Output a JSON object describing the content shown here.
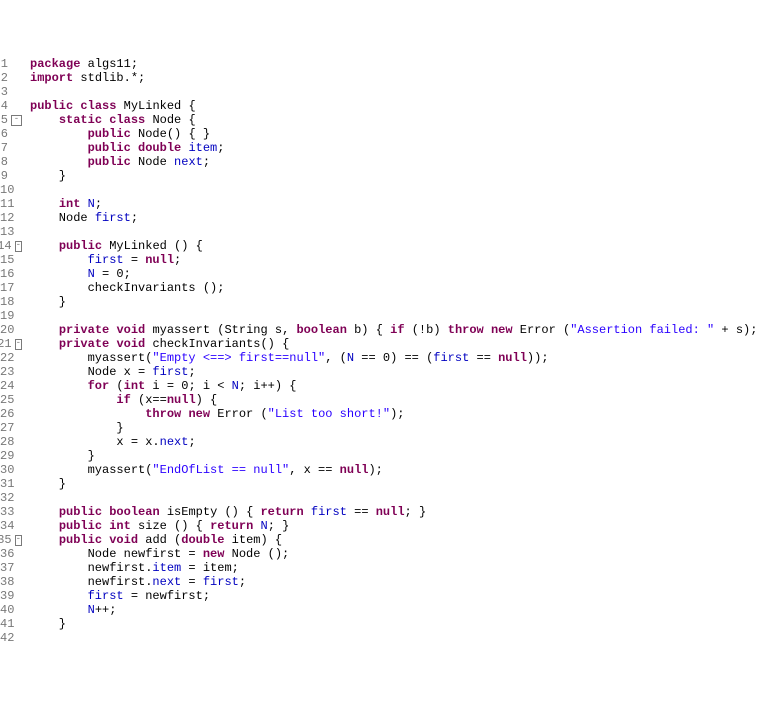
{
  "lines": [
    {
      "n": "1",
      "fold": "",
      "html": [
        [
          "kw",
          "package"
        ],
        [
          "txt",
          " algs11;"
        ]
      ]
    },
    {
      "n": "2",
      "fold": "",
      "html": [
        [
          "kw",
          "import"
        ],
        [
          "txt",
          " stdlib.*;"
        ]
      ]
    },
    {
      "n": "3",
      "fold": "",
      "html": [
        [
          "txt",
          ""
        ]
      ]
    },
    {
      "n": "4",
      "fold": "",
      "html": [
        [
          "kw",
          "public"
        ],
        [
          "txt",
          " "
        ],
        [
          "kw",
          "class"
        ],
        [
          "txt",
          " MyLinked {"
        ]
      ]
    },
    {
      "n": "5",
      "fold": "⊖",
      "html": [
        [
          "txt",
          "    "
        ],
        [
          "kw",
          "static"
        ],
        [
          "txt",
          " "
        ],
        [
          "kw",
          "class"
        ],
        [
          "txt",
          " Node {"
        ]
      ]
    },
    {
      "n": "6",
      "fold": "",
      "html": [
        [
          "txt",
          "        "
        ],
        [
          "kw",
          "public"
        ],
        [
          "txt",
          " Node() { }"
        ]
      ]
    },
    {
      "n": "7",
      "fold": "",
      "html": [
        [
          "txt",
          "        "
        ],
        [
          "kw",
          "public"
        ],
        [
          "txt",
          " "
        ],
        [
          "kw",
          "double"
        ],
        [
          "txt",
          " "
        ],
        [
          "fld",
          "item"
        ],
        [
          "txt",
          ";"
        ]
      ]
    },
    {
      "n": "8",
      "fold": "",
      "html": [
        [
          "txt",
          "        "
        ],
        [
          "kw",
          "public"
        ],
        [
          "txt",
          " Node "
        ],
        [
          "fld",
          "next"
        ],
        [
          "txt",
          ";"
        ]
      ]
    },
    {
      "n": "9",
      "fold": "",
      "html": [
        [
          "txt",
          "    }"
        ]
      ]
    },
    {
      "n": "10",
      "fold": "",
      "html": [
        [
          "txt",
          ""
        ]
      ]
    },
    {
      "n": "11",
      "fold": "",
      "html": [
        [
          "txt",
          "    "
        ],
        [
          "kw",
          "int"
        ],
        [
          "txt",
          " "
        ],
        [
          "fld",
          "N"
        ],
        [
          "txt",
          ";"
        ]
      ]
    },
    {
      "n": "12",
      "fold": "",
      "html": [
        [
          "txt",
          "    Node "
        ],
        [
          "fld",
          "first"
        ],
        [
          "txt",
          ";"
        ]
      ]
    },
    {
      "n": "13",
      "fold": "",
      "html": [
        [
          "txt",
          ""
        ]
      ]
    },
    {
      "n": "14",
      "fold": "⊖",
      "html": [
        [
          "txt",
          "    "
        ],
        [
          "kw",
          "public"
        ],
        [
          "txt",
          " MyLinked () {"
        ]
      ]
    },
    {
      "n": "15",
      "fold": "",
      "html": [
        [
          "txt",
          "        "
        ],
        [
          "fld",
          "first"
        ],
        [
          "txt",
          " = "
        ],
        [
          "kw",
          "null"
        ],
        [
          "txt",
          ";"
        ]
      ]
    },
    {
      "n": "16",
      "fold": "",
      "html": [
        [
          "txt",
          "        "
        ],
        [
          "fld",
          "N"
        ],
        [
          "txt",
          " = 0;"
        ]
      ]
    },
    {
      "n": "17",
      "fold": "",
      "html": [
        [
          "txt",
          "        checkInvariants ();"
        ]
      ]
    },
    {
      "n": "18",
      "fold": "",
      "html": [
        [
          "txt",
          "    }"
        ]
      ]
    },
    {
      "n": "19",
      "fold": "",
      "html": [
        [
          "txt",
          ""
        ]
      ]
    },
    {
      "n": "20",
      "fold": "",
      "html": [
        [
          "txt",
          "    "
        ],
        [
          "kw",
          "private"
        ],
        [
          "txt",
          " "
        ],
        [
          "kw",
          "void"
        ],
        [
          "txt",
          " myassert (String s, "
        ],
        [
          "kw",
          "boolean"
        ],
        [
          "txt",
          " b) { "
        ],
        [
          "kw",
          "if"
        ],
        [
          "txt",
          " (!b) "
        ],
        [
          "kw",
          "throw"
        ],
        [
          "txt",
          " "
        ],
        [
          "kw",
          "new"
        ],
        [
          "txt",
          " Error ("
        ],
        [
          "str",
          "\"Assertion failed: \""
        ],
        [
          "txt",
          " + s); }"
        ]
      ]
    },
    {
      "n": "21",
      "fold": "⊖",
      "html": [
        [
          "txt",
          "    "
        ],
        [
          "kw",
          "private"
        ],
        [
          "txt",
          " "
        ],
        [
          "kw",
          "void"
        ],
        [
          "txt",
          " checkInvariants() {"
        ]
      ]
    },
    {
      "n": "22",
      "fold": "",
      "html": [
        [
          "txt",
          "        myassert("
        ],
        [
          "str",
          "\"Empty <==> first==null\""
        ],
        [
          "txt",
          ", ("
        ],
        [
          "fld",
          "N"
        ],
        [
          "txt",
          " == 0) == ("
        ],
        [
          "fld",
          "first"
        ],
        [
          "txt",
          " == "
        ],
        [
          "kw",
          "null"
        ],
        [
          "txt",
          "));"
        ]
      ]
    },
    {
      "n": "23",
      "fold": "",
      "html": [
        [
          "txt",
          "        Node x = "
        ],
        [
          "fld",
          "first"
        ],
        [
          "txt",
          ";"
        ]
      ]
    },
    {
      "n": "24",
      "fold": "",
      "html": [
        [
          "txt",
          "        "
        ],
        [
          "kw",
          "for"
        ],
        [
          "txt",
          " ("
        ],
        [
          "kw",
          "int"
        ],
        [
          "txt",
          " i = 0; i < "
        ],
        [
          "fld",
          "N"
        ],
        [
          "txt",
          "; i++) {"
        ]
      ]
    },
    {
      "n": "25",
      "fold": "",
      "html": [
        [
          "txt",
          "            "
        ],
        [
          "kw",
          "if"
        ],
        [
          "txt",
          " (x=="
        ],
        [
          "kw",
          "null"
        ],
        [
          "txt",
          ") {"
        ]
      ]
    },
    {
      "n": "26",
      "fold": "",
      "html": [
        [
          "txt",
          "                "
        ],
        [
          "kw",
          "throw"
        ],
        [
          "txt",
          " "
        ],
        [
          "kw",
          "new"
        ],
        [
          "txt",
          " Error ("
        ],
        [
          "str",
          "\"List too short!\""
        ],
        [
          "txt",
          ");"
        ]
      ]
    },
    {
      "n": "27",
      "fold": "",
      "html": [
        [
          "txt",
          "            }"
        ]
      ]
    },
    {
      "n": "28",
      "fold": "",
      "html": [
        [
          "txt",
          "            x = x."
        ],
        [
          "fld",
          "next"
        ],
        [
          "txt",
          ";"
        ]
      ]
    },
    {
      "n": "29",
      "fold": "",
      "html": [
        [
          "txt",
          "        }"
        ]
      ]
    },
    {
      "n": "30",
      "fold": "",
      "html": [
        [
          "txt",
          "        myassert("
        ],
        [
          "str",
          "\"EndOfList == null\""
        ],
        [
          "txt",
          ", x == "
        ],
        [
          "kw",
          "null"
        ],
        [
          "txt",
          ");"
        ]
      ]
    },
    {
      "n": "31",
      "fold": "",
      "html": [
        [
          "txt",
          "    }"
        ]
      ]
    },
    {
      "n": "32",
      "fold": "",
      "html": [
        [
          "txt",
          ""
        ]
      ]
    },
    {
      "n": "33",
      "fold": "",
      "html": [
        [
          "txt",
          "    "
        ],
        [
          "kw",
          "public"
        ],
        [
          "txt",
          " "
        ],
        [
          "kw",
          "boolean"
        ],
        [
          "txt",
          " isEmpty () { "
        ],
        [
          "kw",
          "return"
        ],
        [
          "txt",
          " "
        ],
        [
          "fld",
          "first"
        ],
        [
          "txt",
          " == "
        ],
        [
          "kw",
          "null"
        ],
        [
          "txt",
          "; }"
        ]
      ]
    },
    {
      "n": "34",
      "fold": "",
      "html": [
        [
          "txt",
          "    "
        ],
        [
          "kw",
          "public"
        ],
        [
          "txt",
          " "
        ],
        [
          "kw",
          "int"
        ],
        [
          "txt",
          " size () { "
        ],
        [
          "kw",
          "return"
        ],
        [
          "txt",
          " "
        ],
        [
          "fld",
          "N"
        ],
        [
          "txt",
          "; }"
        ]
      ]
    },
    {
      "n": "35",
      "fold": "⊖",
      "html": [
        [
          "txt",
          "    "
        ],
        [
          "kw",
          "public"
        ],
        [
          "txt",
          " "
        ],
        [
          "kw",
          "void"
        ],
        [
          "txt",
          " add ("
        ],
        [
          "kw",
          "double"
        ],
        [
          "txt",
          " item) {"
        ]
      ]
    },
    {
      "n": "36",
      "fold": "",
      "html": [
        [
          "txt",
          "        Node newfirst = "
        ],
        [
          "kw",
          "new"
        ],
        [
          "txt",
          " Node ();"
        ]
      ]
    },
    {
      "n": "37",
      "fold": "",
      "html": [
        [
          "txt",
          "        newfirst."
        ],
        [
          "fld",
          "item"
        ],
        [
          "txt",
          " = item;"
        ]
      ]
    },
    {
      "n": "38",
      "fold": "",
      "html": [
        [
          "txt",
          "        newfirst."
        ],
        [
          "fld",
          "next"
        ],
        [
          "txt",
          " = "
        ],
        [
          "fld",
          "first"
        ],
        [
          "txt",
          ";"
        ]
      ]
    },
    {
      "n": "39",
      "fold": "",
      "html": [
        [
          "txt",
          "        "
        ],
        [
          "fld",
          "first"
        ],
        [
          "txt",
          " = newfirst;"
        ]
      ]
    },
    {
      "n": "40",
      "fold": "",
      "html": [
        [
          "txt",
          "        "
        ],
        [
          "fld",
          "N"
        ],
        [
          "txt",
          "++;"
        ]
      ]
    },
    {
      "n": "41",
      "fold": "",
      "html": [
        [
          "txt",
          "    }"
        ]
      ]
    },
    {
      "n": "42",
      "fold": "",
      "html": [
        [
          "txt",
          ""
        ]
      ]
    }
  ]
}
